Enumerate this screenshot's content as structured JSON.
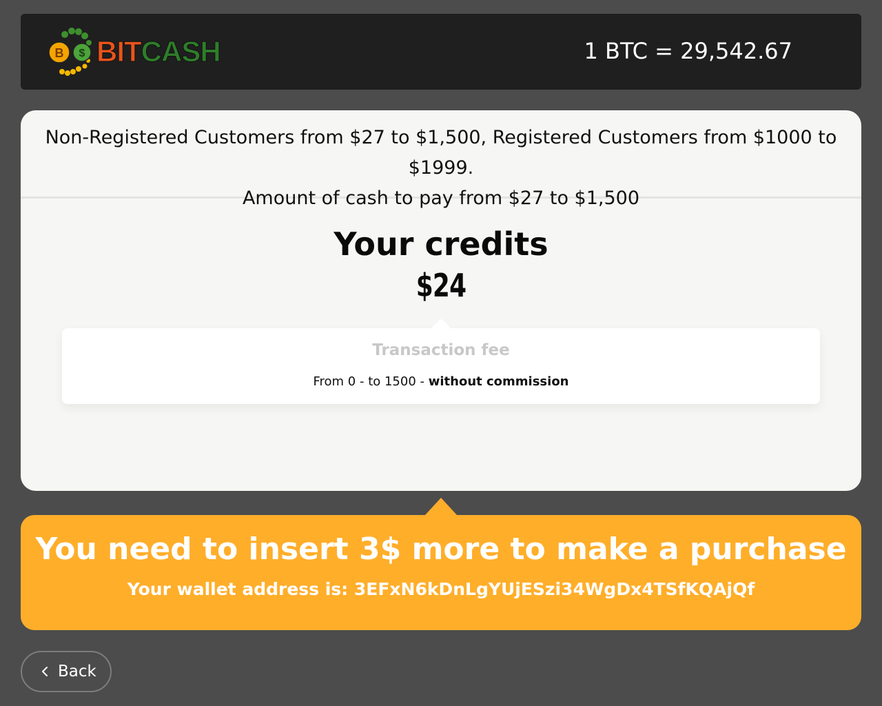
{
  "header": {
    "logo": {
      "text_part1": "BIT",
      "text_part2": "CASH",
      "icon": "bitcoin-dollar-coins-logo"
    },
    "rate": "1 BTC = 29,542.67"
  },
  "notice": {
    "line1": "Non-Registered Customers from $27 to $1,500, Registered Customers from $1000 to $1999.",
    "line2": "Amount of cash to pay from $27 to $1,500"
  },
  "credits": {
    "title": "Your credits",
    "value": "$24"
  },
  "fee": {
    "title": "Transaction fee",
    "range": "From 0 - to 1500 - ",
    "commission": "without commission"
  },
  "alert": {
    "message": "You need to insert 3$ more to make a purchase",
    "wallet": "Your wallet address is: 3EFxN6kDnLgYUjESzi34WgDx4TSfKQAjQf"
  },
  "back": {
    "label": "Back",
    "icon": "chevron-left-icon"
  },
  "colors": {
    "background": "#4c4c4c",
    "header": "#1f1f1f",
    "card": "#f6f6f4",
    "accent": "#ffae2a",
    "logo_bit": "#e8541b",
    "logo_cash": "#2e7d2a"
  }
}
